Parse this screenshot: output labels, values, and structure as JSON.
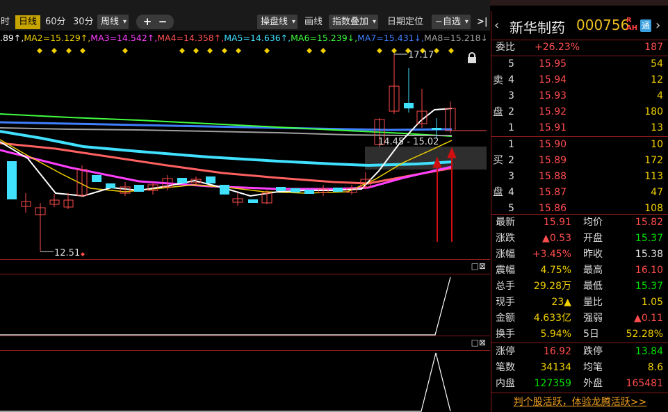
{
  "toolbar": {
    "cut_label": "时",
    "day_label": "日线",
    "m60_label": "60分",
    "m30_label": "30分",
    "week_label": "周线",
    "plus": "+",
    "minus": "−",
    "draw_op_label": "操盘线",
    "draw_label": "画线",
    "index_overlay_label": "指数叠加",
    "date_locate_label": "日期定位",
    "watchlist_label": "−自选",
    "expand_icon": ">|"
  },
  "ma_row": [
    {
      "text": ".89↑,",
      "color": "#ffffff"
    },
    {
      "text": "MA2=15.129↑,",
      "color": "#f0d000"
    },
    {
      "text": "MA3=14.542↑,",
      "color": "#ff40ff"
    },
    {
      "text": "MA4=14.358↑,",
      "color": "#ff5050"
    },
    {
      "text": "MA5=14.636↑,",
      "color": "#40e0ff"
    },
    {
      "text": "MA6=15.239↓,",
      "color": "#40ff40"
    },
    {
      "text": "MA7=15.431↓,",
      "color": "#4080ff"
    },
    {
      "text": "MA8=15.218↓",
      "color": "#a0a0a0"
    },
    {
      "text": "?",
      "color": "#f0d000"
    }
  ],
  "chart": {
    "high_label": "17.17",
    "low_label": "12.51",
    "range_label": "14.45 - 15.02"
  },
  "sub_panel_icons": "□⊠",
  "quote": {
    "stock_name": "新华制药",
    "stock_code": "000756",
    "rah": "R\nAH",
    "tong": "通",
    "nav_prev": "‹",
    "nav_next": "›",
    "weibi_label": "委比",
    "weibi_pct": "+26.23%",
    "weibi_val": "187",
    "sell_char1": "卖",
    "sell_char2": "盘",
    "buy_char1": "买",
    "buy_char2": "盘",
    "sell": [
      {
        "level": "5",
        "price": "15.95",
        "vol": "54"
      },
      {
        "level": "4",
        "price": "15.94",
        "vol": "12"
      },
      {
        "level": "3",
        "price": "15.93",
        "vol": "4"
      },
      {
        "level": "2",
        "price": "15.92",
        "vol": "180"
      },
      {
        "level": "1",
        "price": "15.91",
        "vol": "13"
      }
    ],
    "buy": [
      {
        "level": "1",
        "price": "15.90",
        "vol": "10"
      },
      {
        "level": "2",
        "price": "15.89",
        "vol": "172"
      },
      {
        "level": "3",
        "price": "15.88",
        "vol": "113"
      },
      {
        "level": "4",
        "price": "15.87",
        "vol": "47"
      },
      {
        "level": "5",
        "price": "15.86",
        "vol": "108"
      }
    ],
    "stats": [
      {
        "l1": "最新",
        "v1": "15.91",
        "c1": "red",
        "l2": "均价",
        "v2": "15.82",
        "c2": "red"
      },
      {
        "l1": "涨跌",
        "v1": "▲0.53",
        "c1": "red",
        "l2": "开盘",
        "v2": "15.37",
        "c2": "green"
      },
      {
        "l1": "涨幅",
        "v1": "+3.45%",
        "c1": "red",
        "l2": "昨收",
        "v2": "15.38",
        "c2": "white"
      },
      {
        "l1": "震幅",
        "v1": "4.75%",
        "c1": "yellow",
        "l2": "最高",
        "v2": "16.10",
        "c2": "red"
      },
      {
        "l1": "总手",
        "v1": "29.28万",
        "c1": "yellow",
        "l2": "最低",
        "v2": "15.37",
        "c2": "green"
      },
      {
        "l1": "现手",
        "v1": "23▲",
        "c1": "yellow",
        "l2": "量比",
        "v2": "1.05",
        "c2": "yellow"
      },
      {
        "l1": "金额",
        "v1": "4.633亿",
        "c1": "yellow",
        "l2": "强弱",
        "v2": "▲0.11",
        "c2": "red"
      },
      {
        "l1": "换手",
        "v1": "5.94%",
        "c1": "yellow",
        "l2": "5日",
        "v2": "52.28%",
        "c2": "yellow"
      },
      {
        "l1": "涨停",
        "v1": "16.92",
        "c1": "red",
        "l2": "跌停",
        "v2": "13.84",
        "c2": "green"
      },
      {
        "l1": "笔数",
        "v1": "34134",
        "c1": "yellow",
        "l2": "均笔",
        "v2": "8.6",
        "c2": "yellow"
      },
      {
        "l1": "内盘",
        "v1": "127359",
        "c1": "green",
        "l2": "外盘",
        "v2": "165481",
        "c2": "red"
      }
    ],
    "promo": "判个股活跃，体验龙腾活跃>>"
  },
  "colors": {
    "up": "#ff4d4d",
    "down": "#40e0ff",
    "accent": "#c8a400",
    "border": "#8a1a1a"
  }
}
